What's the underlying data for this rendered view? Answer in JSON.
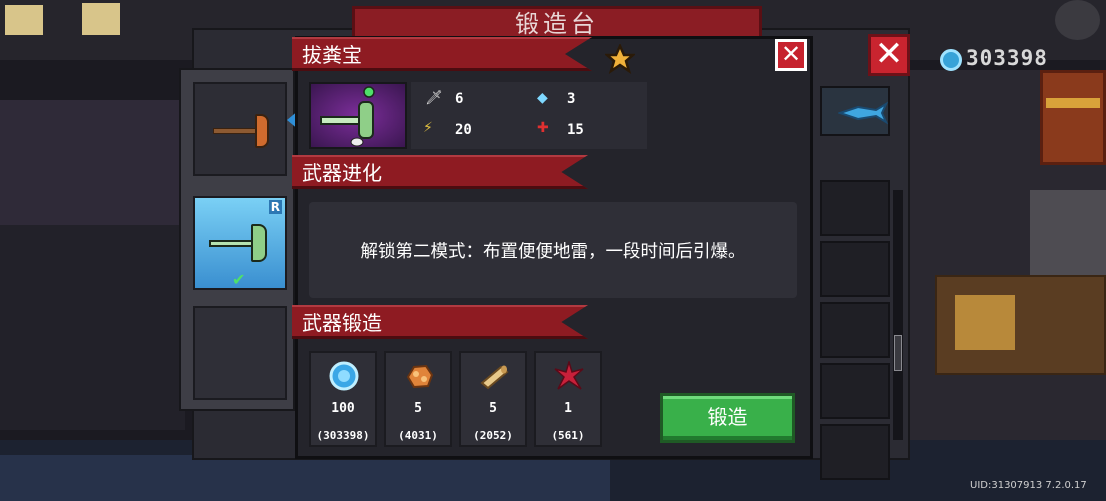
{
  "forge": {
    "title": "锻造台",
    "currency_value": "303398",
    "uid_text": "UID:31307913 7.2.0.17"
  },
  "weapon": {
    "name": "拔粪宝",
    "rarity": "R",
    "stats": {
      "damage": "6",
      "energy": "3",
      "crit": "20",
      "accuracy": "15"
    }
  },
  "evolution": {
    "heading": "武器进化",
    "description": "解锁第二模式：布置便便地雷，一段时间后引爆。"
  },
  "forging": {
    "heading": "武器锻造",
    "button_label": "锻造",
    "materials": [
      {
        "icon": "gem-icon",
        "required": "100",
        "owned": "(303398)"
      },
      {
        "icon": "ore-icon",
        "required": "5",
        "owned": "(4031)"
      },
      {
        "icon": "timber-icon",
        "required": "5",
        "owned": "(2052)"
      },
      {
        "icon": "red-crystal-icon",
        "required": "1",
        "owned": "(561)"
      }
    ]
  },
  "colors": {
    "ribbon_red": "#8e1b22",
    "forge_green": "#39b04a",
    "close_red": "#c6222e",
    "selected_slot_blue": "#5fb6e8"
  }
}
